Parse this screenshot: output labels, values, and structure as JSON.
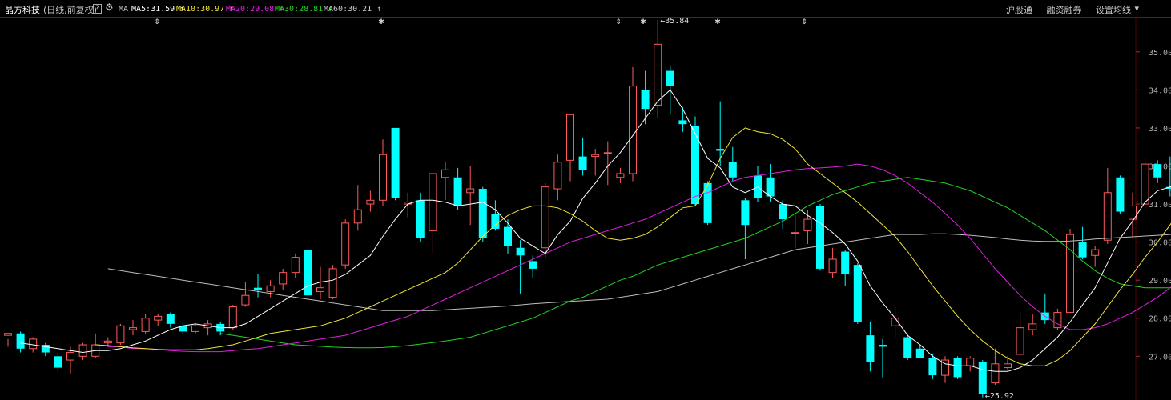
{
  "header": {
    "stock_name": "晶方科技",
    "period": "(日线,前复权)",
    "help_icon": "?",
    "settings_icon": "gear-icon",
    "ma_prefix": "MA",
    "ma_items": [
      {
        "label": "MA5:31.59",
        "arrow": "↑",
        "color": "#ffffff"
      },
      {
        "label": "MA10:30.97",
        "arrow": "↑",
        "color": "#f2e33a"
      },
      {
        "label": "MA20:29.08",
        "arrow": "↑",
        "color": "#e020e0"
      },
      {
        "label": "MA30:28.81",
        "arrow": "↑",
        "color": "#23d323"
      },
      {
        "label": "MA60:30.21",
        "arrow": "↑",
        "color": "#c8c8c8"
      }
    ],
    "links": [
      "沪股通",
      "融资融券",
      "设置均线"
    ],
    "dropdown_icon": "▾"
  },
  "chart_data": {
    "type": "candlestick",
    "y_ticks": [
      "35.00",
      "34.00",
      "33.00",
      "32.00",
      "31.00",
      "30.00",
      "29.00",
      "28.00",
      "27.00"
    ],
    "ylim": [
      25.85,
      35.9
    ],
    "high_label": "35.84",
    "low_label": "25.92",
    "colors": {
      "up": "#ff5a5a",
      "down": "#00ffff",
      "bg": "#000000",
      "grid": "#5a0000"
    },
    "candles": [
      [
        27.55,
        27.6,
        27.25,
        27.45
      ],
      [
        27.6,
        27.2,
        27.1,
        27.65
      ],
      [
        27.2,
        27.45,
        27.1,
        27.5
      ],
      [
        27.3,
        27.1,
        27.0,
        27.35
      ],
      [
        27.0,
        26.7,
        26.6,
        27.1
      ],
      [
        26.9,
        27.1,
        26.55,
        27.25
      ],
      [
        27.0,
        27.3,
        26.9,
        27.35
      ],
      [
        27.0,
        27.3,
        26.95,
        27.6
      ],
      [
        27.35,
        27.4,
        27.25,
        27.5
      ],
      [
        27.35,
        27.8,
        27.3,
        27.85
      ],
      [
        27.7,
        27.75,
        27.55,
        27.95
      ],
      [
        27.65,
        28.0,
        27.6,
        28.1
      ],
      [
        27.95,
        28.05,
        27.8,
        28.1
      ],
      [
        28.1,
        27.85,
        27.75,
        28.15
      ],
      [
        27.8,
        27.65,
        27.55,
        27.9
      ],
      [
        27.65,
        27.8,
        27.6,
        27.85
      ],
      [
        27.75,
        27.85,
        27.55,
        27.95
      ],
      [
        27.85,
        27.65,
        27.55,
        27.9
      ],
      [
        27.75,
        28.3,
        27.7,
        28.35
      ],
      [
        28.35,
        28.6,
        28.3,
        28.95
      ],
      [
        28.8,
        28.75,
        28.55,
        29.15
      ],
      [
        28.7,
        28.85,
        28.55,
        29.0
      ],
      [
        28.9,
        29.2,
        28.75,
        29.3
      ],
      [
        29.2,
        29.6,
        29.05,
        29.7
      ],
      [
        29.8,
        28.6,
        28.5,
        29.85
      ],
      [
        28.7,
        28.8,
        28.5,
        29.35
      ],
      [
        28.55,
        29.3,
        28.5,
        29.4
      ],
      [
        29.4,
        30.5,
        29.3,
        30.6
      ],
      [
        30.5,
        30.85,
        30.3,
        31.5
      ],
      [
        31.0,
        31.1,
        30.8,
        31.35
      ],
      [
        31.1,
        32.3,
        30.95,
        32.7
      ],
      [
        33.0,
        31.15,
        31.1,
        33.0
      ],
      [
        31.0,
        31.05,
        30.65,
        31.3
      ],
      [
        31.1,
        30.1,
        30.0,
        31.3
      ],
      [
        30.3,
        31.8,
        29.7,
        31.8
      ],
      [
        31.7,
        31.9,
        31.1,
        32.1
      ],
      [
        31.7,
        30.95,
        30.85,
        31.95
      ],
      [
        31.3,
        31.4,
        30.45,
        32.0
      ],
      [
        31.4,
        30.1,
        30.0,
        31.45
      ],
      [
        30.75,
        30.35,
        30.3,
        31.1
      ],
      [
        30.4,
        29.9,
        29.7,
        30.6
      ],
      [
        29.85,
        29.65,
        28.65,
        30.05
      ],
      [
        29.5,
        29.3,
        29.05,
        29.65
      ],
      [
        29.85,
        31.45,
        29.6,
        31.55
      ],
      [
        31.4,
        32.1,
        31.1,
        32.3
      ],
      [
        32.15,
        33.35,
        31.6,
        32.8
      ],
      [
        32.25,
        31.9,
        31.75,
        32.75
      ],
      [
        32.25,
        32.3,
        31.75,
        32.45
      ],
      [
        32.35,
        32.35,
        31.5,
        32.65
      ],
      [
        31.7,
        31.8,
        31.55,
        31.95
      ],
      [
        31.8,
        34.1,
        31.6,
        34.6
      ],
      [
        34.0,
        33.5,
        33.1,
        34.5
      ],
      [
        33.6,
        35.2,
        33.25,
        35.84
      ],
      [
        34.5,
        34.1,
        33.35,
        34.65
      ],
      [
        33.2,
        33.1,
        32.9,
        33.55
      ],
      [
        33.05,
        31.0,
        30.95,
        33.3
      ],
      [
        31.55,
        30.5,
        30.45,
        31.6
      ],
      [
        32.45,
        32.4,
        32.0,
        33.7
      ],
      [
        32.1,
        31.7,
        31.6,
        32.5
      ],
      [
        31.1,
        30.45,
        29.55,
        31.15
      ],
      [
        31.75,
        31.15,
        31.05,
        32.0
      ],
      [
        31.7,
        31.2,
        31.05,
        32.05
      ],
      [
        31.0,
        30.6,
        30.35,
        31.1
      ],
      [
        30.25,
        30.25,
        29.85,
        30.7
      ],
      [
        30.3,
        30.6,
        29.95,
        30.85
      ],
      [
        30.95,
        29.3,
        29.25,
        31.0
      ],
      [
        29.2,
        29.55,
        29.05,
        29.85
      ],
      [
        29.75,
        29.15,
        28.85,
        29.8
      ],
      [
        29.4,
        27.9,
        27.85,
        29.45
      ],
      [
        27.55,
        26.85,
        26.6,
        27.9
      ],
      [
        27.3,
        27.25,
        26.45,
        27.45
      ],
      [
        27.8,
        28.0,
        27.5,
        28.3
      ],
      [
        27.5,
        26.95,
        26.9,
        27.6
      ],
      [
        27.2,
        26.95,
        26.95,
        27.3
      ],
      [
        26.95,
        26.5,
        26.4,
        27.05
      ],
      [
        26.5,
        26.9,
        26.3,
        27.0
      ],
      [
        26.95,
        26.45,
        26.4,
        27.0
      ],
      [
        26.75,
        26.95,
        26.6,
        27.0
      ],
      [
        26.85,
        26.0,
        25.92,
        26.9
      ],
      [
        26.3,
        26.8,
        26.25,
        27.2
      ],
      [
        26.7,
        26.8,
        26.65,
        27.0
      ],
      [
        27.05,
        27.75,
        27.0,
        28.15
      ],
      [
        27.7,
        27.85,
        27.55,
        28.1
      ],
      [
        28.15,
        27.95,
        27.85,
        28.65
      ],
      [
        27.75,
        28.15,
        27.7,
        28.25
      ],
      [
        28.15,
        30.2,
        28.15,
        30.35
      ],
      [
        30.0,
        29.6,
        29.55,
        30.4
      ],
      [
        29.65,
        29.8,
        29.35,
        29.9
      ],
      [
        30.05,
        31.3,
        29.95,
        31.95
      ],
      [
        31.7,
        30.8,
        30.75,
        31.75
      ],
      [
        30.6,
        30.95,
        30.15,
        31.3
      ],
      [
        31.0,
        32.05,
        30.85,
        32.2
      ],
      [
        32.05,
        31.7,
        31.55,
        32.15
      ],
      [
        31.45,
        31.4,
        31.2,
        32.25
      ],
      [
        31.75,
        31.95,
        31.8,
        32.85
      ]
    ],
    "ma5": [
      27.35,
      27.3,
      27.25,
      27.2,
      27.15,
      27.1,
      27.15,
      27.15,
      27.2,
      27.3,
      27.4,
      27.55,
      27.7,
      27.8,
      27.85,
      27.8,
      27.75,
      27.75,
      27.85,
      28.05,
      28.25,
      28.45,
      28.65,
      28.85,
      28.95,
      29.0,
      29.15,
      29.4,
      29.65,
      30.15,
      30.6,
      31.0,
      31.1,
      31.1,
      31.05,
      30.95,
      31.0,
      31.05,
      30.85,
      30.5,
      30.1,
      29.9,
      29.7,
      30.2,
      30.55,
      31.15,
      31.55,
      32.0,
      32.35,
      32.8,
      33.25,
      33.7,
      34.0,
      33.5,
      32.85,
      32.2,
      31.95,
      31.45,
      31.3,
      31.45,
      31.2,
      31.0,
      30.95,
      30.7,
      30.5,
      30.25,
      29.95,
      29.5,
      28.85,
      28.4,
      28.0,
      27.55,
      27.3,
      27.0,
      26.8,
      26.75,
      26.75,
      26.65,
      26.6,
      26.6,
      26.7,
      26.9,
      27.2,
      27.5,
      27.9,
      28.35,
      28.8,
      29.45,
      30.1,
      30.55,
      31.05,
      31.35,
      31.45,
      31.6
    ],
    "ma10": [
      27.3,
      27.28,
      27.25,
      27.22,
      27.2,
      27.18,
      27.17,
      27.17,
      27.17,
      27.2,
      27.25,
      27.3,
      27.4,
      27.5,
      27.6,
      27.65,
      27.7,
      27.75,
      27.8,
      27.9,
      28.0,
      28.15,
      28.3,
      28.45,
      28.6,
      28.75,
      28.9,
      29.05,
      29.2,
      29.45,
      29.8,
      30.15,
      30.45,
      30.7,
      30.85,
      30.95,
      30.95,
      30.9,
      30.75,
      30.55,
      30.3,
      30.1,
      30.05,
      30.1,
      30.2,
      30.4,
      30.65,
      30.9,
      30.95,
      31.5,
      32.2,
      32.75,
      33.0,
      32.9,
      32.85,
      32.7,
      32.45,
      32.05,
      31.8,
      31.55,
      31.3,
      31.05,
      30.75,
      30.45,
      30.15,
      29.75,
      29.3,
      28.85,
      28.45,
      28.05,
      27.7,
      27.4,
      27.15,
      26.95,
      26.8,
      26.75,
      26.75,
      26.9,
      27.15,
      27.5,
      27.85,
      28.3,
      28.75,
      29.15,
      29.6,
      30.0,
      30.45,
      30.95
    ],
    "ma20": [
      27.25,
      27.25,
      27.2,
      27.2,
      27.18,
      27.15,
      27.13,
      27.12,
      27.12,
      27.12,
      27.15,
      27.18,
      27.2,
      27.25,
      27.3,
      27.35,
      27.4,
      27.45,
      27.5,
      27.55,
      27.65,
      27.75,
      27.85,
      27.95,
      28.05,
      28.2,
      28.35,
      28.5,
      28.65,
      28.8,
      28.95,
      29.1,
      29.25,
      29.4,
      29.55,
      29.7,
      29.85,
      30.0,
      30.1,
      30.2,
      30.3,
      30.4,
      30.5,
      30.6,
      30.75,
      30.9,
      31.05,
      31.2,
      31.3,
      31.45,
      31.6,
      31.7,
      31.75,
      31.8,
      31.85,
      31.9,
      31.93,
      31.95,
      31.97,
      32.0,
      32.05,
      32.0,
      31.9,
      31.75,
      31.55,
      31.3,
      31.05,
      30.75,
      30.45,
      30.1,
      29.7,
      29.3,
      28.95,
      28.6,
      28.3,
      28.05,
      27.85,
      27.7,
      27.7,
      27.75,
      27.85,
      28.0,
      28.15,
      28.35,
      28.55,
      28.8,
      29.05
    ],
    "ma30": [
      27.6,
      27.55,
      27.5,
      27.45,
      27.4,
      27.35,
      27.3,
      27.28,
      27.26,
      27.24,
      27.23,
      27.22,
      27.22,
      27.23,
      27.25,
      27.28,
      27.32,
      27.36,
      27.4,
      27.45,
      27.5,
      27.6,
      27.7,
      27.8,
      27.9,
      28.0,
      28.15,
      28.3,
      28.45,
      28.55,
      28.7,
      28.85,
      29.0,
      29.1,
      29.25,
      29.4,
      29.5,
      29.6,
      29.7,
      29.8,
      29.9,
      30.0,
      30.1,
      30.25,
      30.4,
      30.55,
      30.75,
      30.95,
      31.1,
      31.25,
      31.35,
      31.45,
      31.55,
      31.6,
      31.65,
      31.7,
      31.65,
      31.6,
      31.55,
      31.45,
      31.35,
      31.2,
      31.05,
      30.9,
      30.7,
      30.5,
      30.3,
      30.05,
      29.8,
      29.5,
      29.25,
      29.05,
      28.9,
      28.85,
      28.8,
      28.8,
      28.8,
      28.81
    ],
    "ma60": [
      29.3,
      29.25,
      29.2,
      29.15,
      29.1,
      29.05,
      29.0,
      28.95,
      28.9,
      28.85,
      28.8,
      28.75,
      28.7,
      28.65,
      28.6,
      28.55,
      28.5,
      28.45,
      28.4,
      28.35,
      28.3,
      28.25,
      28.2,
      28.2,
      28.2,
      28.2,
      28.2,
      28.22,
      28.24,
      28.26,
      28.28,
      28.3,
      28.32,
      28.35,
      28.38,
      28.4,
      28.42,
      28.44,
      28.46,
      28.48,
      28.5,
      28.55,
      28.6,
      28.65,
      28.7,
      28.8,
      28.9,
      29.0,
      29.1,
      29.2,
      29.3,
      29.4,
      29.5,
      29.6,
      29.7,
      29.8,
      29.85,
      29.9,
      29.95,
      30.0,
      30.05,
      30.1,
      30.15,
      30.2,
      30.2,
      30.2,
      30.22,
      30.22,
      30.2,
      30.18,
      30.15,
      30.12,
      30.08,
      30.05,
      30.03,
      30.02,
      30.02,
      30.03,
      30.05,
      30.08,
      30.1,
      30.12,
      30.14,
      30.16,
      30.18,
      30.2,
      30.21
    ]
  }
}
